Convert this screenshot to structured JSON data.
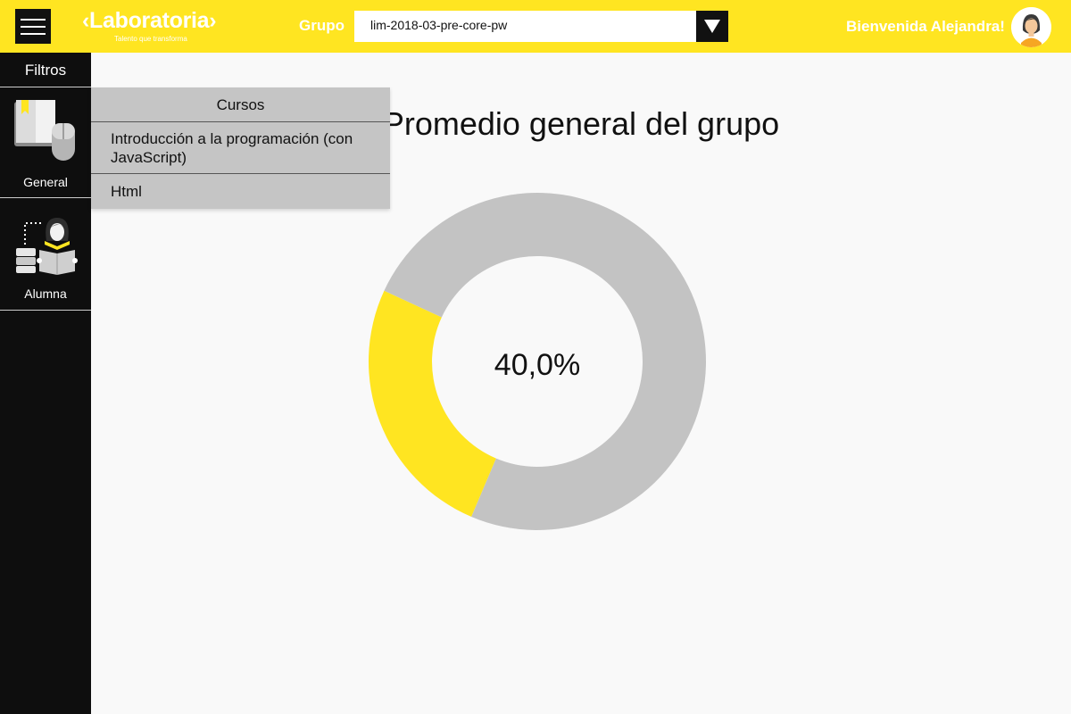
{
  "header": {
    "logo_text": "‹Laboratoria›",
    "logo_tagline": "Talento que transforma",
    "group_label": "Grupo",
    "group_selected": "lim-2018-03-pre-core-pw",
    "welcome": "Bienvenida Alejandra!"
  },
  "sidebar": {
    "title": "Filtros",
    "items": [
      {
        "label": "General",
        "icon": "book-mouse-icon"
      },
      {
        "label": "Alumna",
        "icon": "student-icon"
      }
    ]
  },
  "courses_menu": {
    "title": "Cursos",
    "items": [
      {
        "label": "Introducción a la programación (con JavaScript)"
      },
      {
        "label": "Html"
      }
    ]
  },
  "main": {
    "title": "Promedio general del grupo"
  },
  "chart_data": {
    "type": "pie",
    "donut": true,
    "values": [
      {
        "label": "",
        "percent": 25.5,
        "color": "#ffe521"
      },
      {
        "label": "",
        "percent": 74.5,
        "color": "#c3c3c3"
      }
    ],
    "center_label": "40,0%",
    "start_angle_deg": 203
  },
  "colors": {
    "brand_yellow": "#ffe521",
    "sidebar_bg": "#0e0e0e",
    "dropdown_bg": "#c5c5c5",
    "donut_gray": "#c3c3c3"
  }
}
